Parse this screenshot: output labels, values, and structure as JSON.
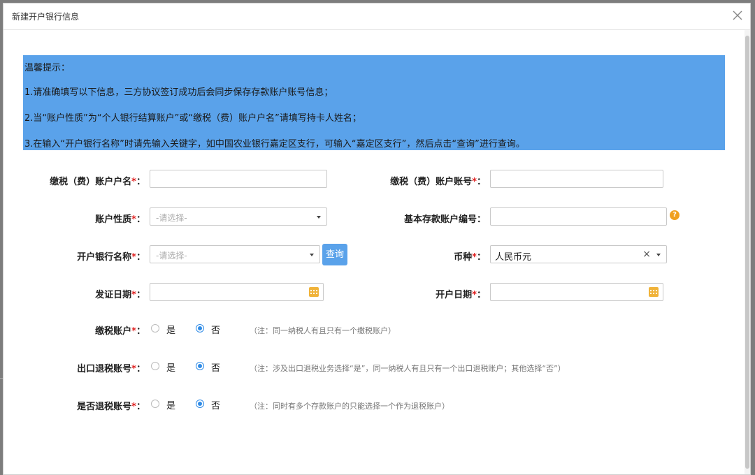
{
  "dialog": {
    "title": "新建开户银行信息"
  },
  "notice": {
    "heading": "温馨提示：",
    "line1": "1.请准确填写以下信息，三方协议签订成功后会同步保存存款账户账号信息；",
    "line2": "2.当“账户性质”为“个人银行结算账户”或“缴税（费）账户户名”请填写持卡人姓名；",
    "line3": "3.在输入“开户银行名称”时请先输入关键字，如中国农业银行嘉定区支行，可输入“嘉定区支行”，然后点击“查询”进行查询。"
  },
  "form": {
    "required_mark": "*",
    "colon": "：",
    "tax_account_name": {
      "label": "缴税（费）账户户名",
      "value": ""
    },
    "tax_account_no": {
      "label": "缴税（费）账户账号",
      "value": ""
    },
    "account_nature": {
      "label": "账户性质",
      "placeholder": "-请选择-"
    },
    "basic_deposit_no": {
      "label": "基本存款账户编号",
      "value": ""
    },
    "bank_name": {
      "label": "开户银行名称",
      "placeholder": "-请选择-",
      "query_label": "查询"
    },
    "currency": {
      "label": "币种",
      "value": "人民币元",
      "clear": "×"
    },
    "issue_date": {
      "label": "发证日期",
      "value": ""
    },
    "open_date": {
      "label": "开户日期",
      "value": ""
    },
    "tax_payment_account": {
      "label": "缴税账户",
      "yes": "是",
      "no": "否",
      "selected": "否",
      "note": "（注：同一纳税人有且只有一个缴税账户）"
    },
    "export_refund_account": {
      "label": "出口退税账号",
      "yes": "是",
      "no": "否",
      "selected": "否",
      "note": "（注：涉及出口退税业务选择“是”，同一纳税人有且只有一个出口退税账户；其他选择“否”）"
    },
    "is_refund_account": {
      "label": "是否退税账号",
      "yes": "是",
      "no": "否",
      "selected": "否",
      "note": "（注：同时有多个存款账户的只能选择一个作为退税账户）"
    }
  },
  "colors": {
    "accent": "#5aa2ea",
    "required": "#e02020",
    "help": "#f0a020"
  },
  "icons": {
    "close": "close-icon",
    "calendar": "calendar-icon",
    "help": "help-icon",
    "dropdown": "chevron-down-icon"
  }
}
